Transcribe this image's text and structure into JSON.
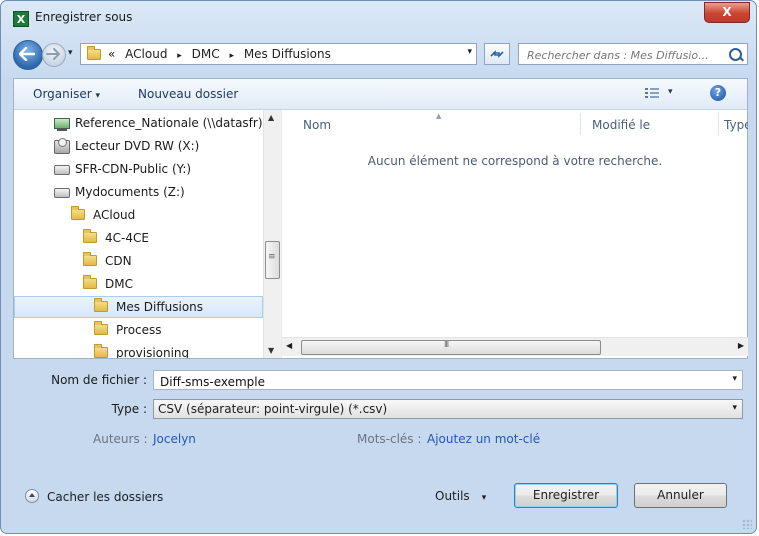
{
  "window": {
    "title": "Enregistrer sous",
    "app_icon": "X",
    "close_label": "X"
  },
  "nav": {
    "breadcrumb": [
      "«",
      "ACloud",
      "▸",
      "DMC",
      "▸",
      "Mes Diffusions"
    ],
    "search_placeholder": "Rechercher dans : Mes Diffusio..."
  },
  "toolbar": {
    "organize": "Organiser",
    "new_folder": "Nouveau dossier",
    "dropdown_glyph": "▾"
  },
  "tree": {
    "items": [
      {
        "label": "Reference_Nationale (\\\\datasfr)",
        "icon": "network-drive-icon"
      },
      {
        "label": "Lecteur DVD RW (X:)",
        "icon": "dvd-drive-icon"
      },
      {
        "label": "SFR-CDN-Public (Y:)",
        "icon": "drive-icon"
      },
      {
        "label": "Mydocuments (Z:)",
        "icon": "drive-icon"
      },
      {
        "label": "ACloud",
        "icon": "folder-icon"
      },
      {
        "label": "4C-4CE",
        "icon": "folder-icon"
      },
      {
        "label": "CDN",
        "icon": "folder-icon"
      },
      {
        "label": "DMC",
        "icon": "folder-icon"
      },
      {
        "label": "Mes Diffusions",
        "icon": "folder-icon",
        "selected": true
      },
      {
        "label": "Process",
        "icon": "folder-icon"
      },
      {
        "label": "provisioning",
        "icon": "folder-icon"
      }
    ]
  },
  "list": {
    "columns": [
      "Nom",
      "Modifié le",
      "Type"
    ],
    "empty_message": "Aucun élément ne correspond à votre recherche."
  },
  "form": {
    "filename_label": "Nom de fichier :",
    "filename_value": "Diff-sms-exemple",
    "type_label": "Type :",
    "type_value": "CSV (séparateur: point-virgule) (*.csv)",
    "authors_label": "Auteurs :",
    "authors_value": "Jocelyn",
    "keywords_label": "Mots-clés :",
    "keywords_value": "Ajoutez un mot-clé"
  },
  "footer": {
    "hide_folders": "Cacher les dossiers",
    "tools": "Outils",
    "save": "Enregistrer",
    "cancel": "Annuler"
  },
  "colors": {
    "accent": "#2458b3",
    "selection": "#d6e8fb",
    "close": "#c9462f"
  }
}
